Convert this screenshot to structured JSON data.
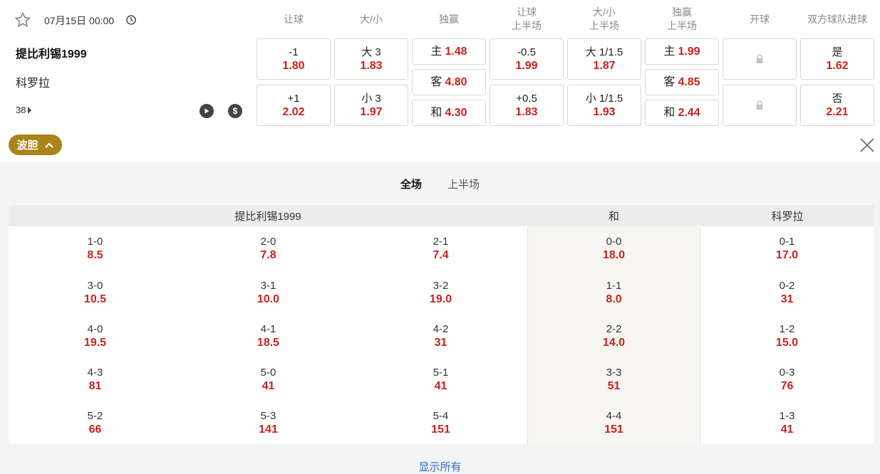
{
  "match": {
    "date": "07月15日 00:00",
    "home": "提比利锡1999",
    "away": "科罗拉",
    "count": "38"
  },
  "columns": [
    {
      "l1": "让球",
      "l2": ""
    },
    {
      "l1": "大/小",
      "l2": ""
    },
    {
      "l1": "独赢",
      "l2": ""
    },
    {
      "l1": "让球",
      "l2": "上半场"
    },
    {
      "l1": "大/小",
      "l2": "上半场"
    },
    {
      "l1": "独赢",
      "l2": "上半场"
    },
    {
      "l1": "开球",
      "l2": ""
    },
    {
      "l1": "双方球队进球",
      "l2": ""
    }
  ],
  "odds": {
    "hcap_ft": [
      {
        "line": "-1",
        "odd": "1.80"
      },
      {
        "line": "+1",
        "odd": "2.02"
      }
    ],
    "ou_ft": [
      {
        "line": "大 3",
        "odd": "1.83"
      },
      {
        "line": "小 3",
        "odd": "1.97"
      }
    ],
    "ml_ft": [
      {
        "label": "主",
        "odd": "1.48"
      },
      {
        "label": "客",
        "odd": "4.80"
      },
      {
        "label": "和",
        "odd": "4.30"
      }
    ],
    "hcap_ht": [
      {
        "line": "-0.5",
        "odd": "1.99"
      },
      {
        "line": "+0.5",
        "odd": "1.83"
      }
    ],
    "ou_ht": [
      {
        "line": "大 1/1.5",
        "odd": "1.87"
      },
      {
        "line": "小 1/1.5",
        "odd": "1.93"
      }
    ],
    "ml_ht": [
      {
        "label": "主",
        "odd": "1.99"
      },
      {
        "label": "客",
        "odd": "4.85"
      },
      {
        "label": "和",
        "odd": "2.44"
      }
    ],
    "btts": [
      {
        "label": "是",
        "odd": "1.62"
      },
      {
        "label": "否",
        "odd": "2.21"
      }
    ]
  },
  "correct_score": {
    "toggle_label": "波胆",
    "tabs": [
      "全场",
      "上半场"
    ],
    "active_tab": "全场",
    "headers": {
      "home": "提比利锡1999",
      "draw": "和",
      "away": "科罗拉"
    },
    "home": [
      [
        {
          "s": "1-0",
          "o": "8.5"
        },
        {
          "s": "2-0",
          "o": "7.8"
        },
        {
          "s": "2-1",
          "o": "7.4"
        }
      ],
      [
        {
          "s": "3-0",
          "o": "10.5"
        },
        {
          "s": "3-1",
          "o": "10.0"
        },
        {
          "s": "3-2",
          "o": "19.0"
        }
      ],
      [
        {
          "s": "4-0",
          "o": "19.5"
        },
        {
          "s": "4-1",
          "o": "18.5"
        },
        {
          "s": "4-2",
          "o": "31"
        }
      ],
      [
        {
          "s": "4-3",
          "o": "81"
        },
        {
          "s": "5-0",
          "o": "41"
        },
        {
          "s": "5-1",
          "o": "41"
        }
      ],
      [
        {
          "s": "5-2",
          "o": "66"
        },
        {
          "s": "5-3",
          "o": "141"
        },
        {
          "s": "5-4",
          "o": "151"
        }
      ]
    ],
    "draw": [
      {
        "s": "0-0",
        "o": "18.0"
      },
      {
        "s": "1-1",
        "o": "8.0"
      },
      {
        "s": "2-2",
        "o": "14.0"
      },
      {
        "s": "3-3",
        "o": "51"
      },
      {
        "s": "4-4",
        "o": "151"
      }
    ],
    "away": [
      {
        "s": "0-1",
        "o": "17.0"
      },
      {
        "s": "0-2",
        "o": "31"
      },
      {
        "s": "1-2",
        "o": "15.0"
      },
      {
        "s": "0-3",
        "o": "76"
      },
      {
        "s": "1-3",
        "o": "41"
      }
    ],
    "show_all": "显示所有"
  },
  "colors": {
    "odds": "#c8231c",
    "accent": "#a88419",
    "link": "#2a6cc8"
  },
  "icons": [
    "star-icon",
    "clock-icon",
    "play-icon",
    "dollar-icon",
    "lock-icon",
    "chevron-up-icon",
    "close-icon"
  ]
}
